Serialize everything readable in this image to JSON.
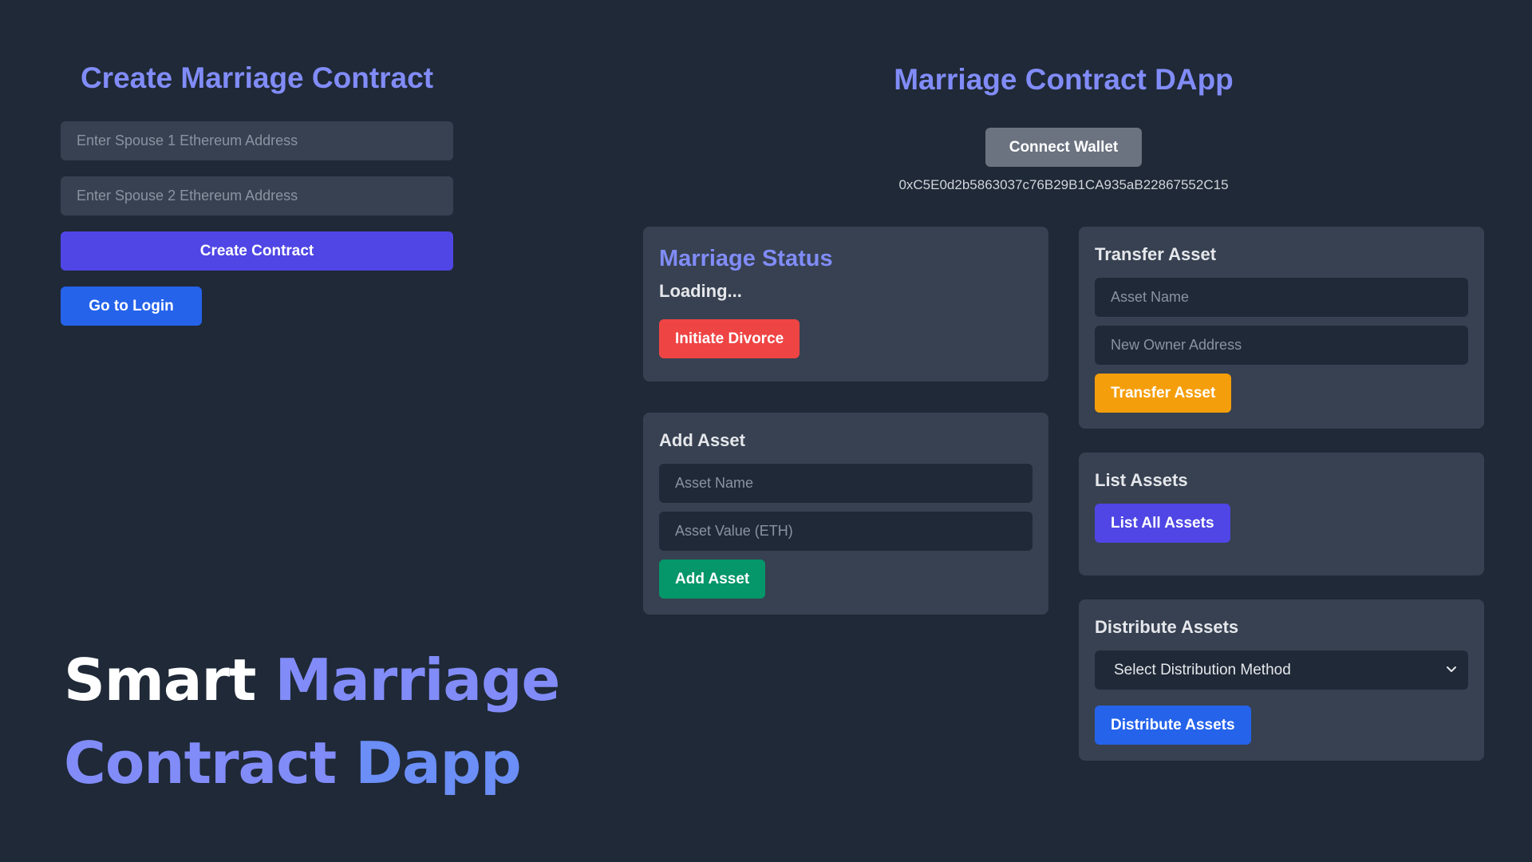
{
  "create_contract": {
    "title": "Create Marriage Contract",
    "spouse1_placeholder": "Enter Spouse 1 Ethereum Address",
    "spouse2_placeholder": "Enter Spouse 2 Ethereum Address",
    "create_button": "Create Contract",
    "login_button": "Go to Login"
  },
  "headline": {
    "word1": "Smart",
    "word2": "Marriage",
    "word3": "Contract",
    "word4": "Dapp"
  },
  "header": {
    "title": "Marriage Contract DApp",
    "connect_button": "Connect Wallet",
    "wallet_address": "0xC5E0d2b5863037c76B29B1CA935aB22867552C15"
  },
  "marriage_status": {
    "title": "Marriage Status",
    "status": "Loading...",
    "divorce_button": "Initiate Divorce"
  },
  "add_asset": {
    "title": "Add Asset",
    "name_placeholder": "Asset Name",
    "value_placeholder": "Asset Value (ETH)",
    "button": "Add Asset"
  },
  "transfer_asset": {
    "title": "Transfer Asset",
    "name_placeholder": "Asset Name",
    "owner_placeholder": "New Owner Address",
    "button": "Transfer Asset"
  },
  "list_assets": {
    "title": "List Assets",
    "button": "List All Assets"
  },
  "distribute_assets": {
    "title": "Distribute Assets",
    "select_value": "Select Distribution Method",
    "button": "Distribute Assets"
  },
  "colors": {
    "background": "#1f2937",
    "card": "#374151",
    "accent_indigo": "#818cf8",
    "create_button": "#4f46e5",
    "login_button": "#2563eb",
    "connect_button": "#6b7280",
    "divorce_button": "#ef4444",
    "add_button": "#059669",
    "transfer_button": "#f59e0b",
    "list_button": "#4f46e5",
    "distribute_button": "#2563eb"
  },
  "icons": {
    "select_chevron": "chevron-down-icon"
  }
}
